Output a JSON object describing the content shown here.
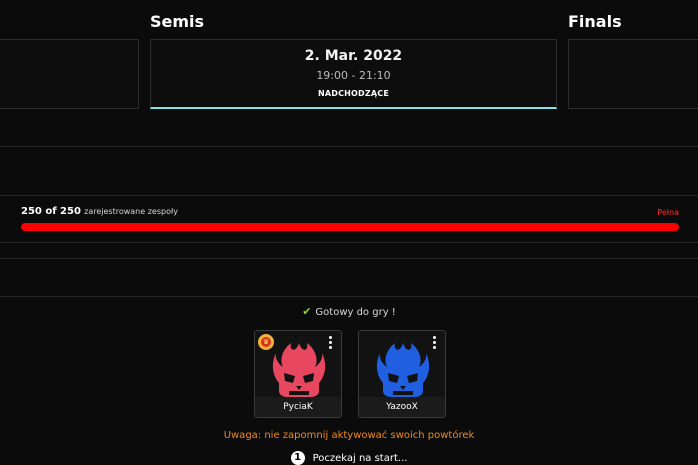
{
  "stages": {
    "semis_title": "Semis",
    "finals_title": "Finals"
  },
  "match": {
    "date": "2. Mar. 2022",
    "time": "19:00 - 21:10",
    "status": "NADCHODZĄCE"
  },
  "registration": {
    "count": "250 of 250",
    "suffix": "zarejestrowane zespoły",
    "status_label": "Pełna",
    "fill_fraction": 1.0
  },
  "ready": {
    "text": "Gotowy do gry !"
  },
  "players": [
    {
      "name": "PyciaK",
      "mascot_color": "#e8485f",
      "has_badge": true
    },
    {
      "name": "YazooX",
      "mascot_color": "#1f5fe0",
      "has_badge": false
    }
  ],
  "warning": "Uwaga: nie zapomnij aktywować swoich powtórek",
  "wait": {
    "step": "1",
    "text": "Poczekaj na start..."
  },
  "colors": {
    "accent_cyan": "#7fe3e6",
    "progress_red": "#ff0000",
    "warning_orange": "#f28a1d",
    "ready_check_green": "#8ed62a"
  }
}
